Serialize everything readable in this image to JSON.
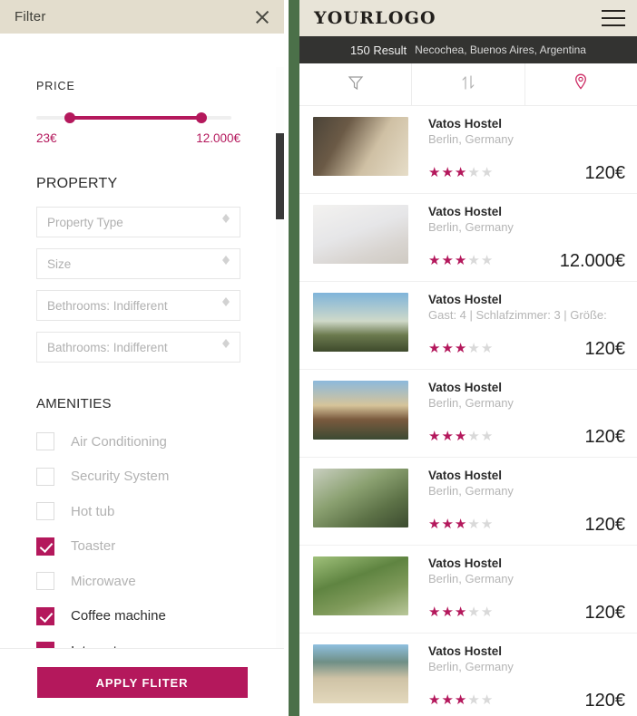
{
  "filter": {
    "title": "Filter",
    "close_icon": "close-icon",
    "price": {
      "label": "PRICE",
      "min_value": "23€",
      "max_value": "12.000€",
      "accent_color": "#b4185c"
    },
    "property": {
      "label": "PROPERTY",
      "fields": [
        {
          "placeholder": "Property Type",
          "name": "property-type"
        },
        {
          "placeholder": "Size",
          "name": "size"
        },
        {
          "placeholder": "Bethrooms: Indifferent",
          "name": "bethrooms"
        },
        {
          "placeholder": "Bathrooms: Indifferent",
          "name": "bathrooms"
        }
      ]
    },
    "amenities": {
      "label": "AMENITIES",
      "items": [
        {
          "label": "Air Conditioning",
          "checked": false
        },
        {
          "label": "Security System",
          "checked": false
        },
        {
          "label": "Hot tub",
          "checked": false
        },
        {
          "label": "Toaster",
          "checked": true
        },
        {
          "label": "Microwave",
          "checked": false
        },
        {
          "label": "Coffee machine",
          "checked": true
        },
        {
          "label": "Internet",
          "checked": true
        }
      ]
    },
    "apply_label": "APPLY FLITER"
  },
  "app": {
    "logo": "YOURLOGO",
    "menu_icon": "hamburger-icon",
    "results": {
      "count": "150 Result",
      "location": "Necochea, Buenos Aires, Argentina"
    },
    "tools": [
      {
        "name": "filter-icon",
        "active": false
      },
      {
        "name": "sort-icon",
        "active": false
      },
      {
        "name": "map-pin-icon",
        "active": true
      }
    ],
    "listings": [
      {
        "title": "Vatos Hostel",
        "subtitle": "Berlin, Germany",
        "rating": 3,
        "price": "120€"
      },
      {
        "title": "Vatos Hostel",
        "subtitle": "Berlin, Germany",
        "rating": 3,
        "price": "12.000€"
      },
      {
        "title": "Vatos Hostel",
        "subtitle": "Gast: 4  |  Schlafzimmer: 3  |  Größe:",
        "rating": 3,
        "price": "120€"
      },
      {
        "title": "Vatos Hostel",
        "subtitle": "Berlin, Germany",
        "rating": 3,
        "price": "120€"
      },
      {
        "title": "Vatos Hostel",
        "subtitle": "Berlin, Germany",
        "rating": 3,
        "price": "120€"
      },
      {
        "title": "Vatos Hostel",
        "subtitle": "Berlin, Germany",
        "rating": 3,
        "price": "120€"
      },
      {
        "title": "Vatos Hostel",
        "subtitle": "Berlin, Germany",
        "rating": 3,
        "price": "120€"
      }
    ],
    "max_rating": 5
  }
}
